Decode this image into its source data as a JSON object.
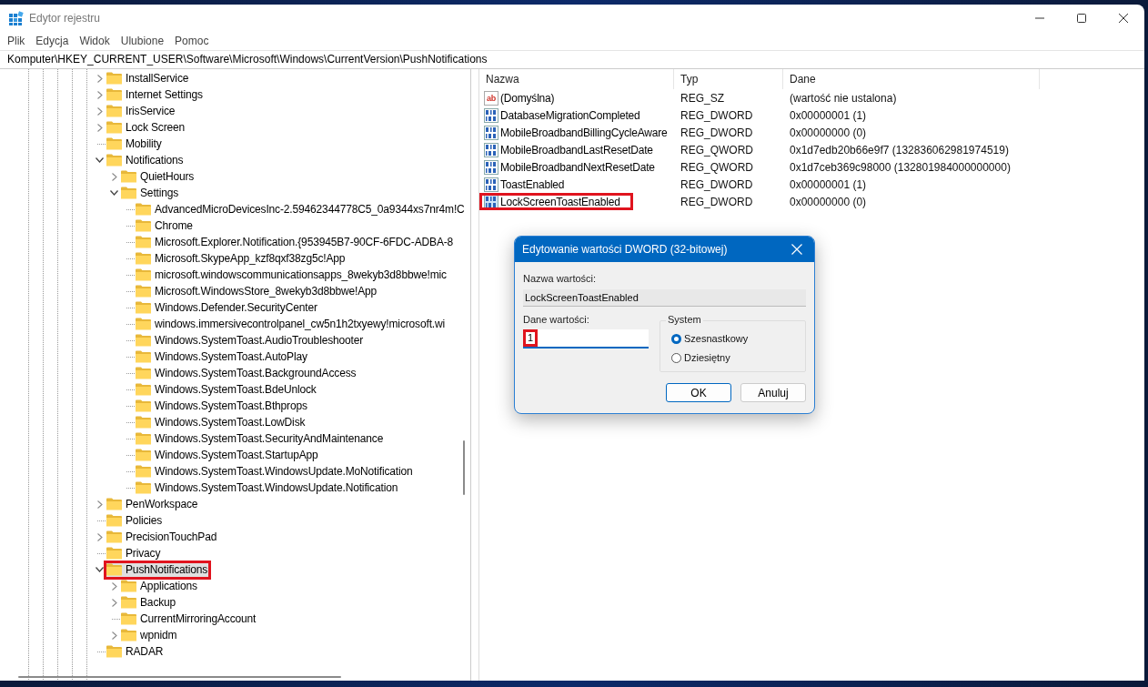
{
  "window": {
    "title": "Edytor rejestru"
  },
  "menu": [
    "Plik",
    "Edycja",
    "Widok",
    "Ulubione",
    "Pomoc"
  ],
  "address": "Komputer\\HKEY_CURRENT_USER\\Software\\Microsoft\\Windows\\CurrentVersion\\PushNotifications",
  "tree": {
    "items": [
      {
        "label": "InstallService",
        "kind": "branch",
        "expanded": false,
        "selected": false
      },
      {
        "label": "Internet Settings",
        "kind": "branch",
        "expanded": false,
        "selected": false
      },
      {
        "label": "IrisService",
        "kind": "branch",
        "expanded": false,
        "selected": false
      },
      {
        "label": "Lock Screen",
        "kind": "branch",
        "expanded": false,
        "selected": false
      },
      {
        "label": "Mobility",
        "kind": "leaf",
        "expanded": false,
        "selected": false
      },
      {
        "label": "Notifications",
        "expanded": true,
        "selected": false,
        "children": [
          {
            "label": "QuietHours",
            "kind": "branch",
            "expanded": false,
            "selected": false
          },
          {
            "label": "Settings",
            "expanded": true,
            "selected": false,
            "children": [
              {
                "label": "AdvancedMicroDevicesInc-2.59462344778C5_0a9344xs7nr4m!C",
                "kind": "leaf",
                "expanded": false,
                "selected": false
              },
              {
                "label": "Chrome",
                "kind": "leaf",
                "expanded": false,
                "selected": false
              },
              {
                "label": "Microsoft.Explorer.Notification.{953945B7-90CF-6FDC-ADBA-8",
                "kind": "leaf",
                "expanded": false,
                "selected": false
              },
              {
                "label": "Microsoft.SkypeApp_kzf8qxf38zg5c!App",
                "kind": "leaf",
                "expanded": false,
                "selected": false
              },
              {
                "label": "microsoft.windowscommunicationsapps_8wekyb3d8bbwe!mic",
                "kind": "leaf",
                "expanded": false,
                "selected": false
              },
              {
                "label": "Microsoft.WindowsStore_8wekyb3d8bbwe!App",
                "kind": "leaf",
                "expanded": false,
                "selected": false
              },
              {
                "label": "Windows.Defender.SecurityCenter",
                "kind": "leaf",
                "expanded": false,
                "selected": false
              },
              {
                "label": "windows.immersivecontrolpanel_cw5n1h2txyewy!microsoft.wi",
                "kind": "leaf",
                "expanded": false,
                "selected": false
              },
              {
                "label": "Windows.SystemToast.AudioTroubleshooter",
                "kind": "leaf",
                "expanded": false,
                "selected": false
              },
              {
                "label": "Windows.SystemToast.AutoPlay",
                "kind": "leaf",
                "expanded": false,
                "selected": false
              },
              {
                "label": "Windows.SystemToast.BackgroundAccess",
                "kind": "leaf",
                "expanded": false,
                "selected": false
              },
              {
                "label": "Windows.SystemToast.BdeUnlock",
                "kind": "leaf",
                "expanded": false,
                "selected": false
              },
              {
                "label": "Windows.SystemToast.Bthprops",
                "kind": "leaf",
                "expanded": false,
                "selected": false
              },
              {
                "label": "Windows.SystemToast.LowDisk",
                "kind": "leaf",
                "expanded": false,
                "selected": false
              },
              {
                "label": "Windows.SystemToast.SecurityAndMaintenance",
                "kind": "leaf",
                "expanded": false,
                "selected": false
              },
              {
                "label": "Windows.SystemToast.StartupApp",
                "kind": "leaf",
                "expanded": false,
                "selected": false
              },
              {
                "label": "Windows.SystemToast.WindowsUpdate.MoNotification",
                "kind": "leaf",
                "expanded": false,
                "selected": false
              },
              {
                "label": "Windows.SystemToast.WindowsUpdate.Notification",
                "kind": "leaf",
                "expanded": false,
                "selected": false
              }
            ]
          }
        ]
      },
      {
        "label": "PenWorkspace",
        "kind": "branch",
        "expanded": false,
        "selected": false
      },
      {
        "label": "Policies",
        "kind": "leaf",
        "expanded": false,
        "selected": false
      },
      {
        "label": "PrecisionTouchPad",
        "kind": "branch",
        "expanded": false,
        "selected": false
      },
      {
        "label": "Privacy",
        "kind": "leaf",
        "expanded": false,
        "selected": false
      },
      {
        "label": "PushNotifications",
        "expanded": true,
        "selected": true,
        "children": [
          {
            "label": "Applications",
            "kind": "branch",
            "expanded": false,
            "selected": false
          },
          {
            "label": "Backup",
            "kind": "branch",
            "expanded": false,
            "selected": false
          },
          {
            "label": "CurrentMirroringAccount",
            "kind": "leaf",
            "expanded": false,
            "selected": false
          },
          {
            "label": "wpnidm",
            "kind": "branch",
            "expanded": false,
            "selected": false
          }
        ]
      },
      {
        "label": "RADAR",
        "kind": "leaf",
        "expanded": false,
        "selected": false
      }
    ]
  },
  "values": {
    "columns": [
      "Nazwa",
      "Typ",
      "Dane"
    ],
    "rows": [
      {
        "name": "(Domyślna)",
        "type": "REG_SZ",
        "data": "(wartość nie ustalona)",
        "kind": "string",
        "icon_text": "ab",
        "selected": false
      },
      {
        "name": "DatabaseMigrationCompleted",
        "type": "REG_DWORD",
        "data": "0x00000001 (1)",
        "kind": "binary",
        "selected": false
      },
      {
        "name": "MobileBroadbandBillingCycleAware",
        "type": "REG_DWORD",
        "data": "0x00000000 (0)",
        "kind": "binary",
        "selected": false
      },
      {
        "name": "MobileBroadbandLastResetDate",
        "type": "REG_QWORD",
        "data": "0x1d7edb20b66e9f7 (132836062981974519)",
        "kind": "binary",
        "selected": false
      },
      {
        "name": "MobileBroadbandNextResetDate",
        "type": "REG_QWORD",
        "data": "0x1d7ceb369c98000 (132801984000000000)",
        "kind": "binary",
        "selected": false
      },
      {
        "name": "ToastEnabled",
        "type": "REG_DWORD",
        "data": "0x00000001 (1)",
        "kind": "binary",
        "selected": false
      },
      {
        "name": "LockScreenToastEnabled",
        "type": "REG_DWORD",
        "data": "0x00000000 (0)",
        "kind": "binary",
        "selected": true
      }
    ]
  },
  "dialog": {
    "title": "Edytowanie wartości DWORD (32-bitowej)",
    "name_label": "Nazwa wartości:",
    "name_value": "LockScreenToastEnabled",
    "data_label": "Dane wartości:",
    "data_value": "1",
    "data_highlighted": true,
    "base_label": "System",
    "bases": [
      {
        "label": "Szesnastkowy",
        "selected": true
      },
      {
        "label": "Dziesiętny",
        "selected": false
      }
    ],
    "buttons": [
      {
        "label": "OK",
        "default": true
      },
      {
        "label": "Anuluj",
        "default": false
      }
    ]
  }
}
